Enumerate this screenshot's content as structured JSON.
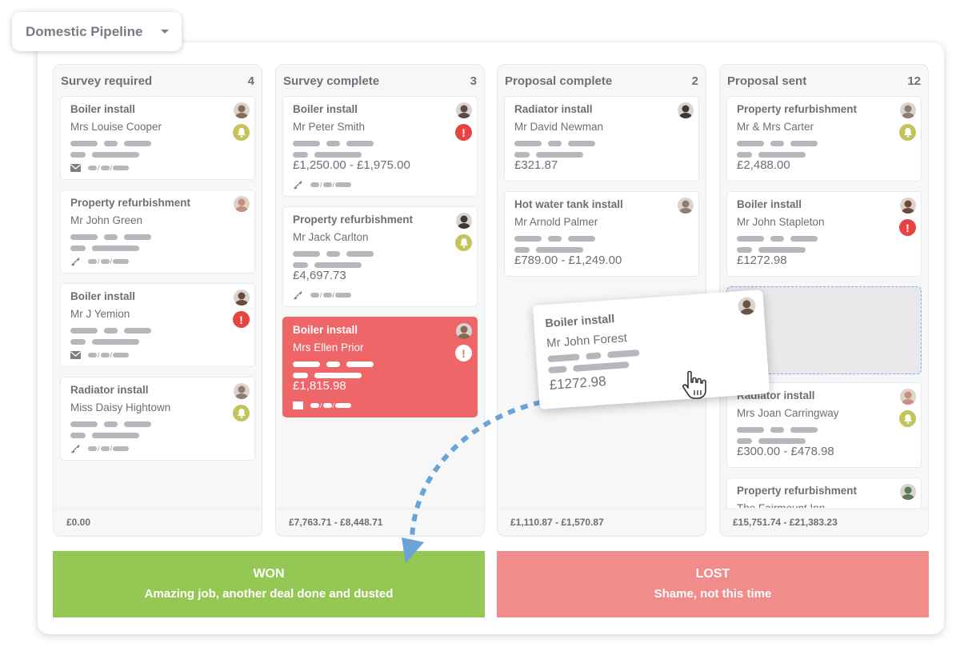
{
  "pipeline_selector": {
    "label": "Domestic Pipeline",
    "icon": "caret-down-icon"
  },
  "columns": [
    {
      "title": "Survey required",
      "count": "4",
      "total": "£0.00",
      "cards": [
        {
          "title": "Boiler install",
          "name": "Mrs Louise Cooper",
          "value": null,
          "contact": "email",
          "status": "bell",
          "avatar_color": "#8a6a55"
        },
        {
          "title": "Property refurbishment",
          "name": "Mr John Green",
          "value": null,
          "contact": "phone",
          "status": null,
          "avatar_color": "#c98f7e"
        },
        {
          "title": "Boiler install",
          "name": "Mr J Yemion",
          "value": null,
          "contact": "email",
          "status": "alert",
          "avatar_color": "#6d4a36"
        },
        {
          "title": "Radiator install",
          "name": "Miss Daisy Hightown",
          "value": null,
          "contact": "phone",
          "status": "bell",
          "avatar_color": "#8e7d70"
        }
      ]
    },
    {
      "title": "Survey complete",
      "count": "3",
      "total": "£7,763.71 - £8,448.71",
      "cards": [
        {
          "title": "Boiler install",
          "name": "Mr Peter Smith",
          "value": "£1,250.00 - £1,975.00",
          "contact": "phone",
          "status": "alert",
          "avatar_color": "#5a4a44"
        },
        {
          "title": "Property refurbishment",
          "name": "Mr Jack Carlton",
          "value": "£4,697.73",
          "contact": "phone",
          "status": "bell",
          "avatar_color": "#3d3a37"
        },
        {
          "title": "Boiler install",
          "name": "Mrs Ellen Prior",
          "value": "£1,815.98",
          "contact": "email",
          "status": "alert",
          "avatar_color": "#8a6a55",
          "highlight": "red"
        }
      ]
    },
    {
      "title": "Proposal complete",
      "count": "2",
      "total": "£1,110.87 - £1,570.87",
      "cards": [
        {
          "title": "Radiator install",
          "name": "Mr David Newman",
          "value": "£321.87",
          "contact": null,
          "status": null,
          "avatar_color": "#3a3936"
        },
        {
          "title": "Hot water tank install",
          "name": "Mr Arnold Palmer",
          "value": "£789.00 - £1,249.00",
          "contact": null,
          "status": null,
          "avatar_color": "#8e7d70"
        }
      ]
    },
    {
      "title": "Proposal sent",
      "count": "12",
      "total": "£15,751.74 - £21,383.23",
      "cards": [
        {
          "title": "Property refurbishment",
          "name": "Mr & Mrs Carter",
          "value": "£2,488.00",
          "contact": null,
          "status": "bell",
          "avatar_color": "#8e7d70"
        },
        {
          "title": "Boiler install",
          "name": "Mr John Stapleton",
          "value": "£1272.98",
          "contact": null,
          "status": "alert",
          "avatar_color": "#6d4a36"
        },
        {
          "placeholder": true
        },
        {
          "title": "Radiator install",
          "name": "Mrs Joan Carringway",
          "value": "£300.00 - £478.98",
          "contact": null,
          "status": "bell",
          "avatar_color": "#c98f7e"
        },
        {
          "title": "Property refurbishment",
          "name": "The Fairmount Inn",
          "value": null,
          "contact": null,
          "status": null,
          "avatar_color": "#5e7a55"
        }
      ]
    }
  ],
  "dragging_card": {
    "title": "Boiler install",
    "name": "Mr John Forest",
    "value": "£1272.98",
    "avatar_color": "#6a5245"
  },
  "outcomes": {
    "won": {
      "title": "WON",
      "subtitle": "Amazing job, another deal done and dusted",
      "color": "#94c754"
    },
    "lost": {
      "title": "LOST",
      "subtitle": "Shame, not this time",
      "color": "#f28c8b"
    }
  },
  "colors": {
    "bell": "#c4c45c",
    "alert": "#e84343",
    "highlight_card": "#ee6668",
    "drop_arrow": "#6aa3d5"
  }
}
